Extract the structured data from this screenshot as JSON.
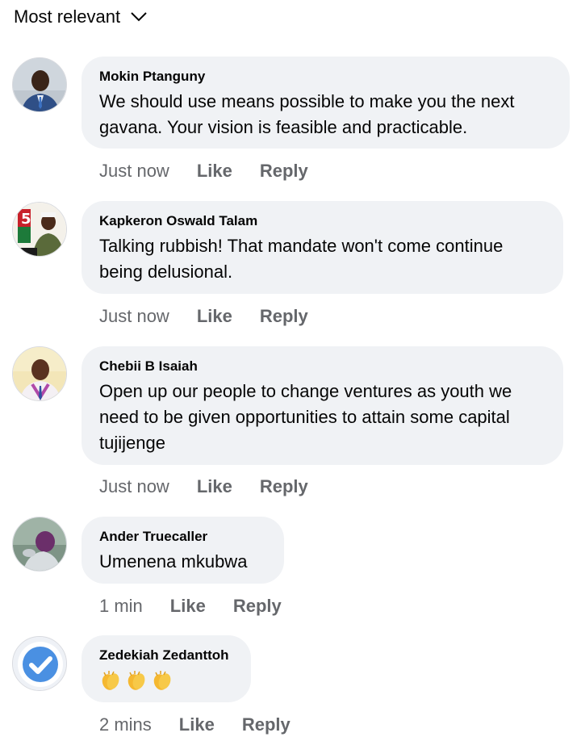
{
  "sort": {
    "label": "Most relevant",
    "icon": "chevron-down-icon"
  },
  "comments": [
    {
      "author": "Mokin Ptanguny",
      "text": "We should use means possible to make you the next gavana. Your vision is feasible and practicable.",
      "time": "Just now",
      "like": "Like",
      "reply": "Reply"
    },
    {
      "author": "Kapkeron Oswald Talam",
      "text": "Talking rubbish! That mandate won't come continue being delusional.",
      "time": "Just now",
      "like": "Like",
      "reply": "Reply"
    },
    {
      "author": "Chebii B Isaiah",
      "text": "Open up our people to change ventures as youth we need  to be given opportunities to attain some capital tujijenge",
      "time": "Just now",
      "like": "Like",
      "reply": "Reply"
    },
    {
      "author": "Ander Truecaller",
      "text": "Umenena mkubwa",
      "time": "1 min",
      "like": "Like",
      "reply": "Reply"
    },
    {
      "author": "Zedekiah Zedanttoh",
      "text": "",
      "emoji": "clapping-hands-icon x3",
      "time": "2 mins",
      "like": "Like",
      "reply": "Reply"
    }
  ],
  "colors": {
    "bubble": "#f0f2f5",
    "secondary_text": "#65676b",
    "verified_blue": "#4a90e2"
  }
}
